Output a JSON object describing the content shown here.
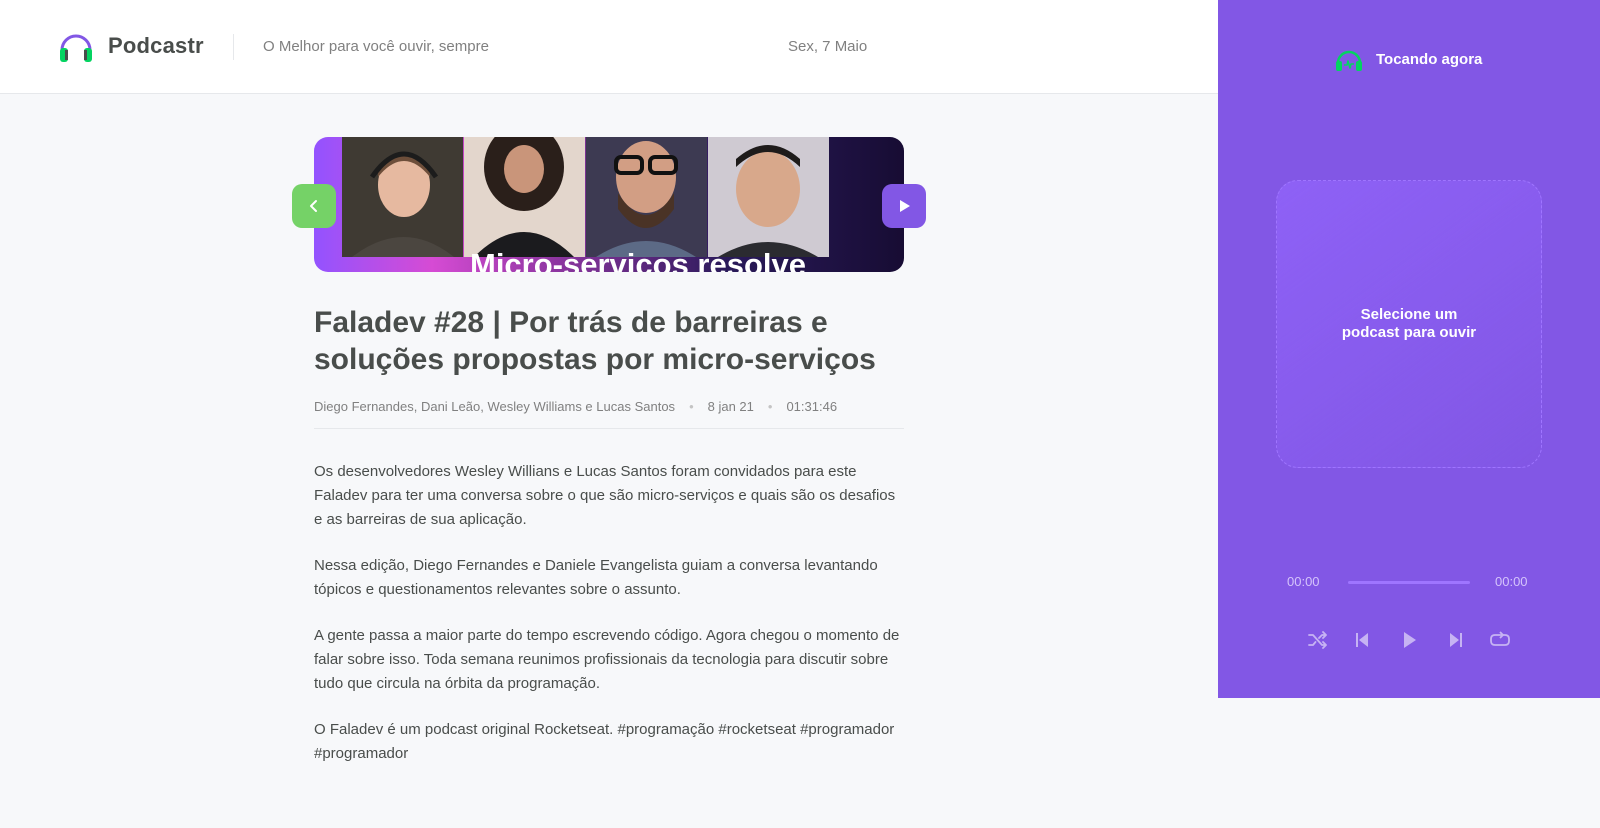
{
  "header": {
    "logo_text": "Podcastr",
    "tagline": "O Melhor para você ouvir, sempre",
    "date": "Sex, 7 Maio"
  },
  "player": {
    "now_playing_label": "Tocando agora",
    "empty_text": "Selecione um podcast para ouvir",
    "current_time": "00:00",
    "duration": "00:00",
    "progress": 0,
    "controls": [
      "shuffle-icon",
      "previous-icon",
      "play-icon",
      "next-icon",
      "repeat-icon"
    ]
  },
  "episode": {
    "thumbnail_caption": "Micro-serviços resolve",
    "title": "Faladev #28 | Por trás de barreiras e soluções propostas por micro-serviços",
    "members": "Diego Fernandes, Dani Leão, Wesley Williams e Lucas Santos",
    "published_at": "8 jan 21",
    "duration": "01:31:46",
    "description": [
      "Os desenvolvedores Wesley Willians e Lucas Santos foram convidados para este Faladev para ter uma conversa sobre o que são micro-serviços e quais são os desafios e as barreiras de sua aplicação.",
      "Nessa edição, Diego Fernandes e Daniele Evangelista guiam a conversa levantando tópicos e questionamentos relevantes sobre o assunto.",
      "A gente passa a maior parte do tempo escrevendo código. Agora chegou o momento de falar sobre isso. Toda semana reunimos profissionais da tecnologia para discutir sobre tudo que circula na órbita da programação.",
      "O Faladev é um podcast original Rocketseat. #programação #rocketseat #programador #programador"
    ]
  },
  "colors": {
    "brand_purple": "#8257e5",
    "accent_green": "#75d267",
    "text_dark": "#494d4b",
    "text_muted": "#808080"
  }
}
